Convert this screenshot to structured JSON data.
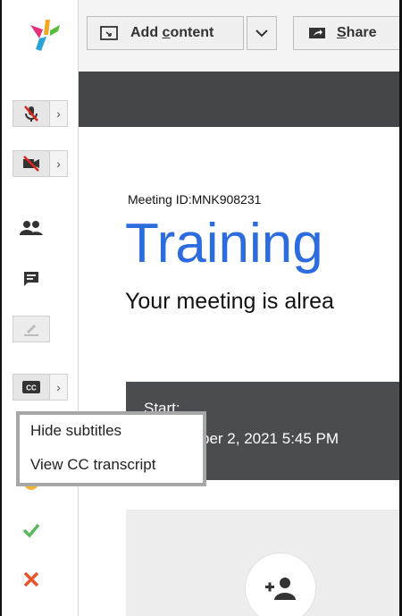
{
  "toolbar": {
    "add_content_prefix": "Add ",
    "add_content_underlined": "c",
    "add_content_suffix": "ontent",
    "share_underlined": "S",
    "share_suffix": "hare"
  },
  "meeting": {
    "id_label": "Meeting ID:MNK908231",
    "title": "Training",
    "subtitle": "Your meeting is alrea",
    "start_label": "Start:",
    "start_date": "ber 2, 2021 5:45 PM"
  },
  "cc_menu": {
    "items": [
      "Hide subtitles",
      "View CC transcript"
    ]
  },
  "colors": {
    "title_blue": "#2d6cdf",
    "approve_green": "#5cb85c",
    "deny_orange": "#e8542b",
    "mute_red": "#d9261c"
  }
}
